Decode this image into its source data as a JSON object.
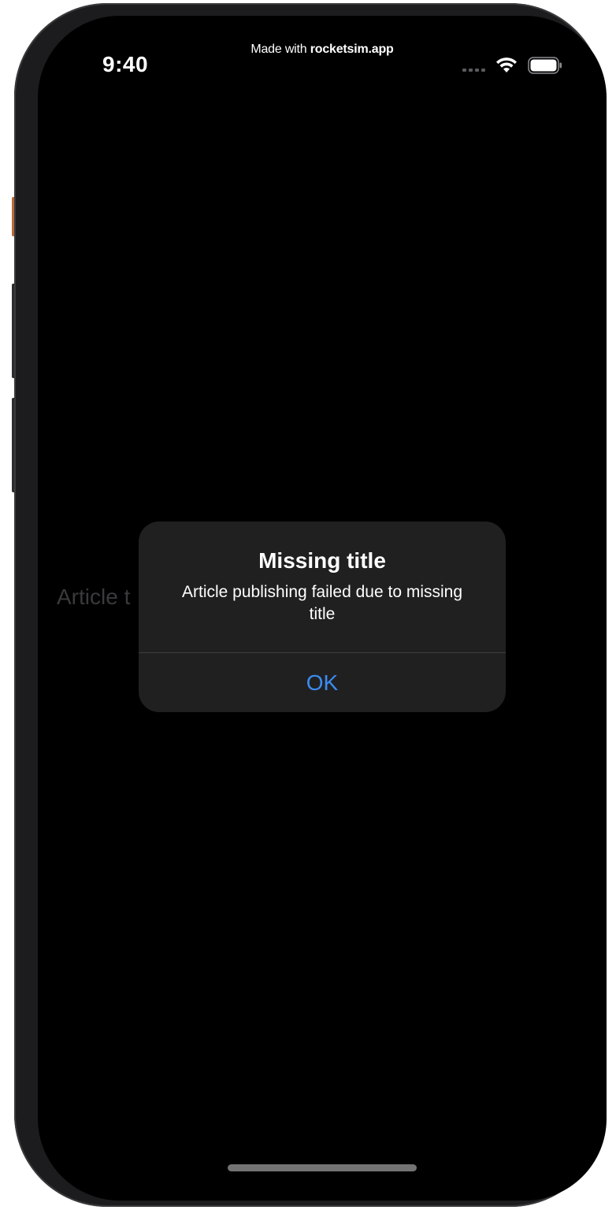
{
  "watermark": {
    "prefix": "Made with ",
    "brand": "rocketsim.app"
  },
  "status_bar": {
    "time": "9:40",
    "icons": [
      "cellular-signal-icon",
      "wifi-icon",
      "battery-icon"
    ]
  },
  "background": {
    "field_placeholder": "Article t"
  },
  "alert": {
    "title": "Missing title",
    "message": "Article publishing failed due to missing title",
    "ok_label": "OK",
    "accent_color": "#3b8cf0"
  },
  "colors": {
    "screen_bg": "#000000",
    "alert_bg": "#202021",
    "text": "#ffffff"
  }
}
